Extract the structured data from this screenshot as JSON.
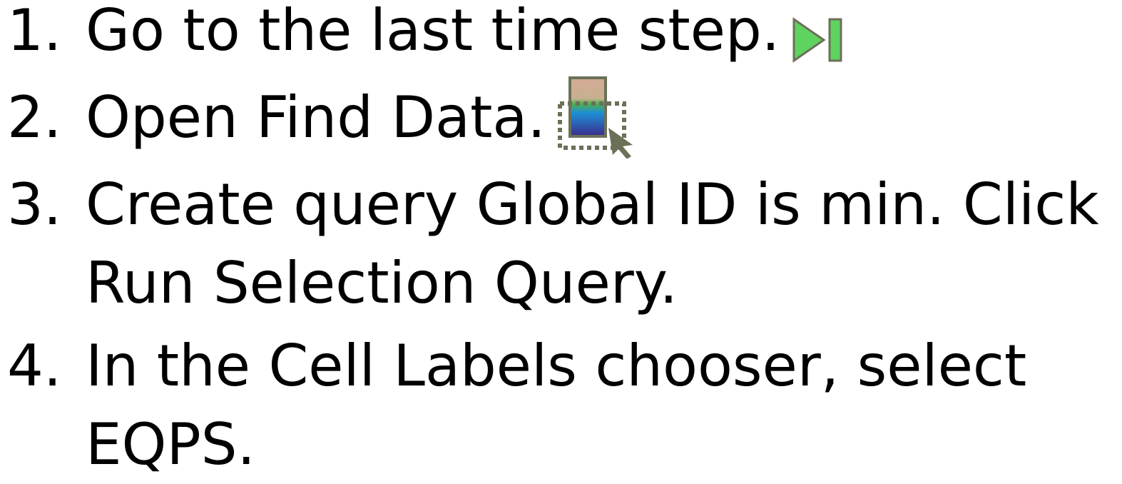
{
  "steps": [
    {
      "number": "1.",
      "text": "Go to the last time step.",
      "icon": "last-time-step-icon"
    },
    {
      "number": "2.",
      "text": "Open Find Data.",
      "icon": "find-data-icon"
    },
    {
      "number": "3.",
      "line1": "Create query Global ID is min. Click",
      "line2": "Run Selection Query."
    },
    {
      "number": "4.",
      "line1": "In the Cell Labels chooser, select",
      "line2": "EQPS."
    }
  ],
  "colors": {
    "text": "#000000",
    "play_green": "#5fd35f",
    "icon_border": "#6b7058",
    "gradient_top": "#d4aa96",
    "gradient_mid": "#1e8fd6",
    "gradient_bottom": "#3a2a8a"
  }
}
